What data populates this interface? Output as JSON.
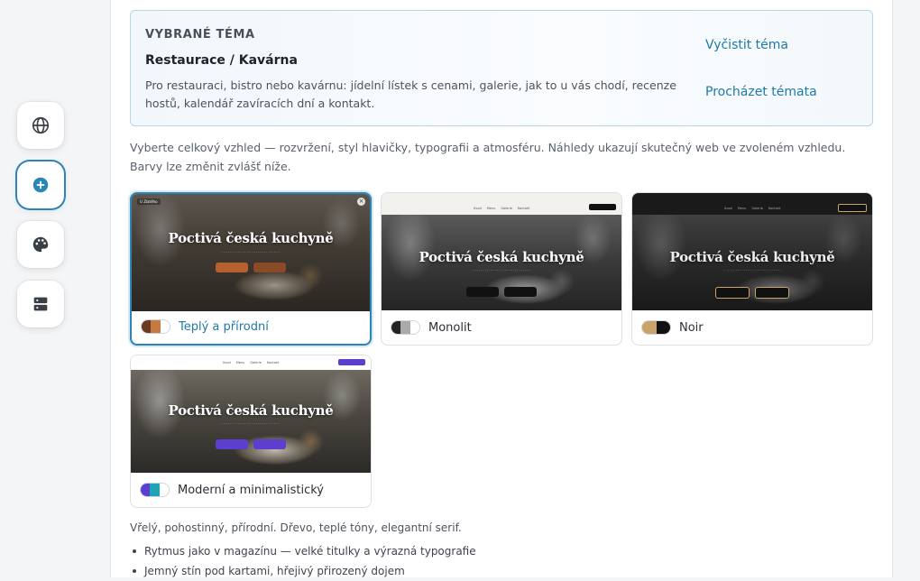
{
  "rail": {
    "items": [
      {
        "name": "globe-icon"
      },
      {
        "name": "plus-circle-icon"
      },
      {
        "name": "palette-icon"
      },
      {
        "name": "server-icon"
      }
    ]
  },
  "selected_theme": {
    "heading": "VYBRANÉ TÉMA",
    "title": "Restaurace / Kavárna",
    "description": "Pro restauraci, bistro nebo kavárnu: jídelní lístek s cenami, galerie, jak to u vás chodí, recenze hostů, kalendář zavíracích dní a kontakt.",
    "clear_label": "Vyčistit téma",
    "browse_label": "Procházet témata"
  },
  "intro": "Vyberte celkový vzhled — rozvržení, styl hlavičky, typografii a atmosféru. Náhledy ukazují skutečný web ve zvoleném vzhledu. Barvy lze změnit zvlášť níže.",
  "styles": [
    {
      "label": "Teplý a přírodní",
      "hero": "Poctivá česká kuchyně",
      "swatch": [
        "#6b3a22",
        "#c8793f",
        "#ffffff"
      ],
      "accent": "#b5602d"
    },
    {
      "label": "Monolit",
      "hero": "Poctivá česká kuchyně",
      "swatch": [
        "#222222",
        "#aaaaaa",
        "#ffffff"
      ],
      "accent": "#111111"
    },
    {
      "label": "Noir",
      "hero": "Poctivá česká kuchyně",
      "swatch": [
        "#c9a36a",
        "#111111"
      ],
      "accent": "#c9a36a"
    },
    {
      "label": "Moderní a minimalistický",
      "hero": "Poctivá česká kuchyně",
      "swatch": [
        "#5a3fd1",
        "#1fa3b5",
        "#ffffff"
      ],
      "accent": "#5a3fd1"
    }
  ],
  "style_description": "Vřelý, pohostinný, přírodní. Dřevo, teplé tóny, elegantní serif.",
  "style_bullets": [
    "Rytmus jako v magazínu — velké titulky a výrazná typografie",
    "Jemný stín pod kartami, hřejivý přirozený dojem"
  ]
}
